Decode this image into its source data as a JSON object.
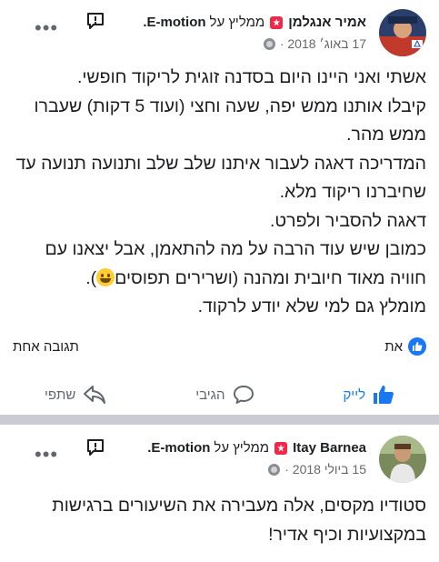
{
  "posts": [
    {
      "author": "אמיר אנגלמן",
      "recommends": "ממליץ על",
      "page": "E-motion.",
      "date": "17 באוג׳ 2018 ·",
      "text": "אשתי ואני היינו היום בסדנה זוגית  לריקוד חופשי.\nקיבלו אותנו ממש יפה, שעה וחצי (ועוד 5 דקות) שעברו ממש מהר.\nהמדריכה דאגה לעבור איתנו שלב שלב ותנועה תנועה עד שחיברנו ריקוד מלא.\nדאגה להסביר ולפרט.\nכמובן שיש עוד הרבה על מה להתאמן, אבל יצאנו עם חוויה מאוד חיובית ומהנה (ושרירים תפוסים",
      "text_end": ").\nמומלץ גם למי שלא יודע לרקוד.",
      "like_count": "את",
      "comment_count": "תגובה אחת",
      "actions": {
        "like": "לייק",
        "comment": "הגיבי",
        "share": "שתפי"
      }
    },
    {
      "author": "Itay Barnea",
      "recommends": "ממליץ על",
      "page": "E-motion.",
      "date": "15 ביולי 2018 ·",
      "text": "סטודיו מקסים, אלה  מעבירה את השיעורים ברגישות במקצועיות וכיף אדיר!"
    }
  ],
  "icons": {
    "globe": "globe-icon",
    "more": "more-options-icon",
    "message": "message-icon",
    "like": "like-icon",
    "comment": "comment-icon",
    "share": "share-icon",
    "recommend": "recommend-badge-icon"
  },
  "colors": {
    "accent": "#1877f2",
    "recommend": "#f02849",
    "separator": "#c9ccd1",
    "muted": "#65676b"
  }
}
